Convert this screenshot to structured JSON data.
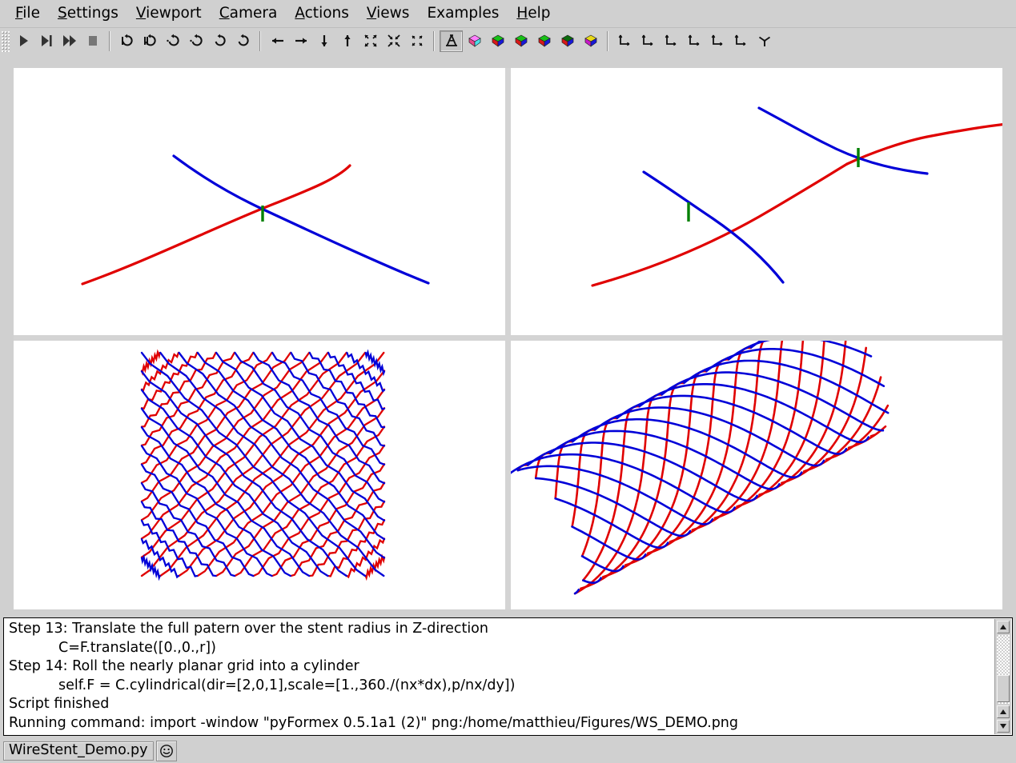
{
  "menubar": {
    "items": [
      {
        "name": "file",
        "label": "File",
        "mnemonic": "F"
      },
      {
        "name": "settings",
        "label": "Settings",
        "mnemonic": "S"
      },
      {
        "name": "viewport",
        "label": "Viewport",
        "mnemonic": "V"
      },
      {
        "name": "camera",
        "label": "Camera",
        "mnemonic": "C"
      },
      {
        "name": "actions",
        "label": "Actions",
        "mnemonic": "A"
      },
      {
        "name": "views",
        "label": "Views",
        "mnemonic": "V"
      },
      {
        "name": "examples",
        "label": "Examples",
        "mnemonic": ""
      },
      {
        "name": "help",
        "label": "Help",
        "mnemonic": "H"
      }
    ]
  },
  "toolbar": {
    "groups": [
      {
        "name": "script-controls",
        "buttons": [
          {
            "name": "play-button",
            "icon": "play-icon",
            "pressed": false
          },
          {
            "name": "step-button",
            "icon": "step-icon",
            "pressed": false
          },
          {
            "name": "continue-button",
            "icon": "fast-forward-icon",
            "pressed": false
          },
          {
            "name": "stop-button",
            "icon": "stop-icon",
            "pressed": false
          }
        ]
      },
      {
        "name": "rotate-controls",
        "buttons": [
          {
            "name": "rotate-left-button",
            "icon": "rotate-left-icon",
            "pressed": false
          },
          {
            "name": "rotate-right-button",
            "icon": "rotate-right-icon",
            "pressed": false
          },
          {
            "name": "rotate-up-button",
            "icon": "rotate-up-icon",
            "pressed": false
          },
          {
            "name": "rotate-down-button",
            "icon": "rotate-down-icon",
            "pressed": false
          },
          {
            "name": "rotate-cw-button",
            "icon": "rotate-clockwise-icon",
            "pressed": false
          },
          {
            "name": "rotate-ccw-button",
            "icon": "rotate-counterclockwise-icon",
            "pressed": false
          }
        ]
      },
      {
        "name": "pan-zoom-controls",
        "buttons": [
          {
            "name": "pan-left-button",
            "icon": "arrow-left-icon",
            "pressed": false
          },
          {
            "name": "pan-right-button",
            "icon": "arrow-right-icon",
            "pressed": false
          },
          {
            "name": "pan-down-button",
            "icon": "arrow-down-icon",
            "pressed": false
          },
          {
            "name": "pan-up-button",
            "icon": "arrow-up-icon",
            "pressed": false
          },
          {
            "name": "zoom-all-button",
            "icon": "zoom-expand-icon",
            "pressed": false
          },
          {
            "name": "zoom-in-button",
            "icon": "zoom-in-icon",
            "pressed": false
          },
          {
            "name": "zoom-out-button",
            "icon": "zoom-out-icon",
            "pressed": false
          }
        ]
      },
      {
        "name": "view-controls",
        "buttons": [
          {
            "name": "perspective-toggle-button",
            "icon": "perspective-icon",
            "pressed": true
          },
          {
            "name": "view-all-button",
            "icon": "cube-multicolor-icon",
            "pressed": false
          },
          {
            "name": "view-front-button",
            "icon": "cube-green-red-icon",
            "pressed": false
          },
          {
            "name": "view-back-button",
            "icon": "cube-green-red2-icon",
            "pressed": false
          },
          {
            "name": "view-right-button",
            "icon": "cube-green-blue-icon",
            "pressed": false
          },
          {
            "name": "view-left-button",
            "icon": "cube-darkgreen-icon",
            "pressed": false
          },
          {
            "name": "view-iso-button",
            "icon": "cube-yellow-icon",
            "pressed": false
          }
        ]
      },
      {
        "name": "axes-controls",
        "buttons": [
          {
            "name": "axes-xz-button",
            "icon": "axes-1-icon",
            "pressed": false
          },
          {
            "name": "axes-yz-button",
            "icon": "axes-2-icon",
            "pressed": false
          },
          {
            "name": "axes-zy-button",
            "icon": "axes-3-icon",
            "pressed": false
          },
          {
            "name": "axes-xy-button",
            "icon": "axes-4-icon",
            "pressed": false
          },
          {
            "name": "axes-zx-button",
            "icon": "axes-5-icon",
            "pressed": false
          },
          {
            "name": "axes-yx-button",
            "icon": "axes-6-icon",
            "pressed": false
          },
          {
            "name": "axes-iso-button",
            "icon": "axes-tripod-icon",
            "pressed": false
          }
        ]
      }
    ]
  },
  "viewports": [
    {
      "name": "viewport-base-cell",
      "description": "Single wire crossing cell: one red and one blue curve with green connector"
    },
    {
      "name": "viewport-double-cell",
      "description": "Two-cell wire pattern with red curve crossing two blue curves"
    },
    {
      "name": "viewport-planar-grid",
      "description": "Planar woven wire grid pattern"
    },
    {
      "name": "viewport-cylindrical-stent",
      "description": "Wire stent rolled into a cylinder"
    }
  ],
  "log": {
    "lines": [
      {
        "text": "Step 13: Translate the full patern over the stent radius in Z-direction",
        "indent": false
      },
      {
        "text": "C=F.translate([0.,0.,r])",
        "indent": true
      },
      {
        "text": "Step 14: Roll the nearly planar grid into a cylinder",
        "indent": false
      },
      {
        "text": "self.F = C.cylindrical(dir=[2,0,1],scale=[1.,360./(nx*dx),p/nx/dy])",
        "indent": true
      },
      {
        "text": "Script finished",
        "indent": false
      },
      {
        "text": "Running command: import -window \"pyFormex 0.5.1a1 (2)\" png:/home/matthieu/Figures/WS_DEMO.png",
        "indent": false
      }
    ]
  },
  "statusbar": {
    "script_name": "WireStent_Demo.py",
    "smiley_icon": "smiley-face-icon"
  },
  "colors": {
    "wire_red": "#e00000",
    "wire_blue": "#0000d8",
    "connector_green": "#008000",
    "window_bg": "#d0d0d0",
    "viewport_bg": "#ffffff",
    "gutter": "#d4d4d4"
  }
}
